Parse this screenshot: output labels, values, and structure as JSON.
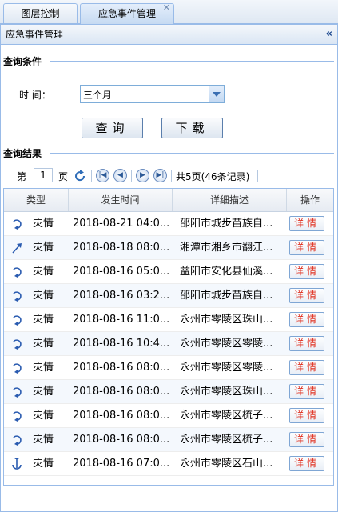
{
  "tabs": [
    {
      "label": "图层控制"
    },
    {
      "label": "应急事件管理"
    }
  ],
  "panel": {
    "title": "应急事件管理",
    "collapse_icon": "«"
  },
  "query": {
    "section_title": "查询条件",
    "time_label": "时  间：",
    "time_value": "三个月",
    "search_button": "查询",
    "download_button": "下载"
  },
  "results": {
    "section_title": "查询结果",
    "pager": {
      "page_prefix": "第",
      "page_value": "1",
      "page_suffix": "页",
      "summary": "共5页(46条记录)"
    },
    "columns": [
      "类型",
      "发生时间",
      "详细描述",
      "操作"
    ],
    "rows": [
      {
        "icon": "curved-arrow-icon",
        "type": "灾情",
        "time": "2018-08-21 04:0...",
        "desc": "邵阳市城步苗族自...",
        "action": "详情"
      },
      {
        "icon": "diagonal-arrow-icon",
        "type": "灾情",
        "time": "2018-08-18 08:0...",
        "desc": "湘潭市湘乡市翻江...",
        "action": "详情"
      },
      {
        "icon": "curved-arrow-icon",
        "type": "灾情",
        "time": "2018-08-16 05:0...",
        "desc": "益阳市安化县仙溪...",
        "action": "详情"
      },
      {
        "icon": "curved-arrow-icon",
        "type": "灾情",
        "time": "2018-08-16 03:2...",
        "desc": "邵阳市城步苗族自...",
        "action": "详情"
      },
      {
        "icon": "curved-arrow-icon",
        "type": "灾情",
        "time": "2018-08-16 11:0...",
        "desc": "永州市零陵区珠山...",
        "action": "详情"
      },
      {
        "icon": "curved-arrow-icon",
        "type": "灾情",
        "time": "2018-08-16 10:4...",
        "desc": "永州市零陵区零陵...",
        "action": "详情"
      },
      {
        "icon": "curved-arrow-icon",
        "type": "灾情",
        "time": "2018-08-16 08:0...",
        "desc": "永州市零陵区零陵...",
        "action": "详情"
      },
      {
        "icon": "curved-arrow-icon",
        "type": "灾情",
        "time": "2018-08-16 08:0...",
        "desc": "永州市零陵区珠山...",
        "action": "详情"
      },
      {
        "icon": "curved-arrow-icon",
        "type": "灾情",
        "time": "2018-08-16 08:0...",
        "desc": "永州市零陵区梳子...",
        "action": "详情"
      },
      {
        "icon": "curved-arrow-icon",
        "type": "灾情",
        "time": "2018-08-16 08:0...",
        "desc": "永州市零陵区梳子...",
        "action": "详情"
      },
      {
        "icon": "anchor-arrow-icon",
        "type": "灾情",
        "time": "2018-08-16 07:0...",
        "desc": "永州市零陵区石山...",
        "action": "详情"
      }
    ]
  },
  "colors": {
    "border": "#99bbe8",
    "icon_blue": "#2a5bb0",
    "detail_red": "#e03222"
  }
}
